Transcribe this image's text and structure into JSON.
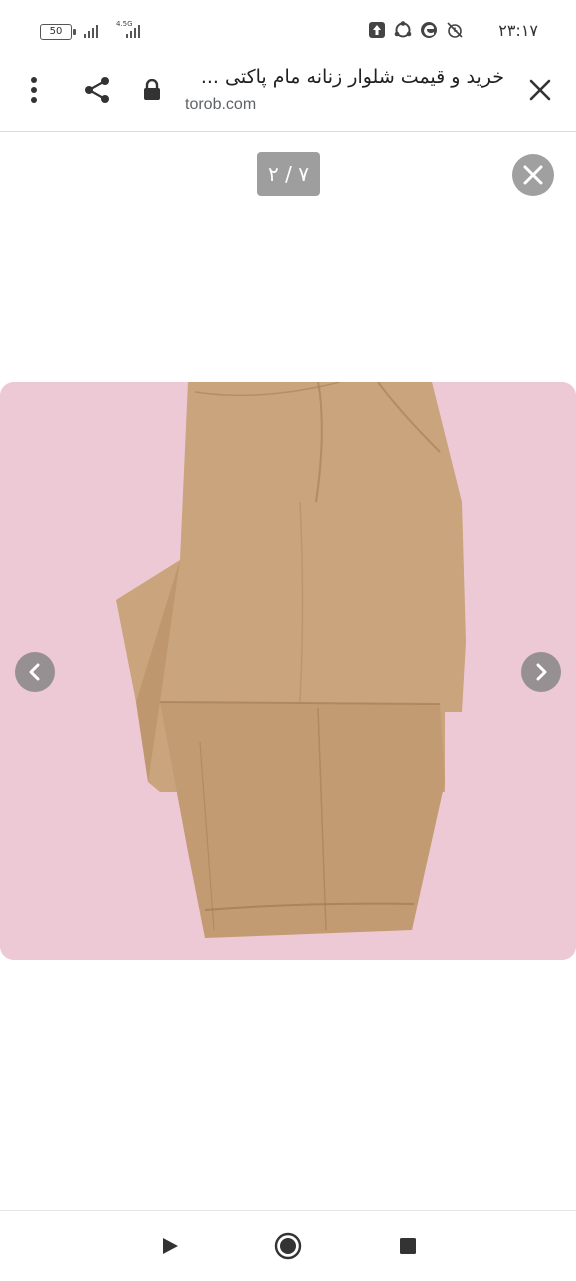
{
  "status_bar": {
    "battery": "50",
    "network": "4.5G",
    "time": "۲۳:۱۷",
    "icons": [
      "upload-icon",
      "sync-icon",
      "edge-browser-icon",
      "silent-alarm-icon"
    ]
  },
  "toolbar": {
    "title": "خرید و قیمت شلوار زنانه مام پاکتی ...",
    "url": "torob.com",
    "icons": [
      "close-icon",
      "lock-icon",
      "share-icon",
      "more-vert-icon"
    ]
  },
  "viewer": {
    "counter": "۲ / ۷",
    "current_index": 2,
    "total": 7,
    "image": "beige women's trousers on pink background",
    "icons": [
      "close-circle-icon",
      "chevron-left-icon",
      "chevron-right-icon"
    ]
  },
  "colors": {
    "photo_background": "#ecc9d4",
    "trousers": "#c9a47c",
    "counter_background": "#9e9e9e"
  },
  "system_nav": {
    "icons": [
      "back-play-icon",
      "home-circle-icon",
      "recents-square-icon"
    ]
  }
}
